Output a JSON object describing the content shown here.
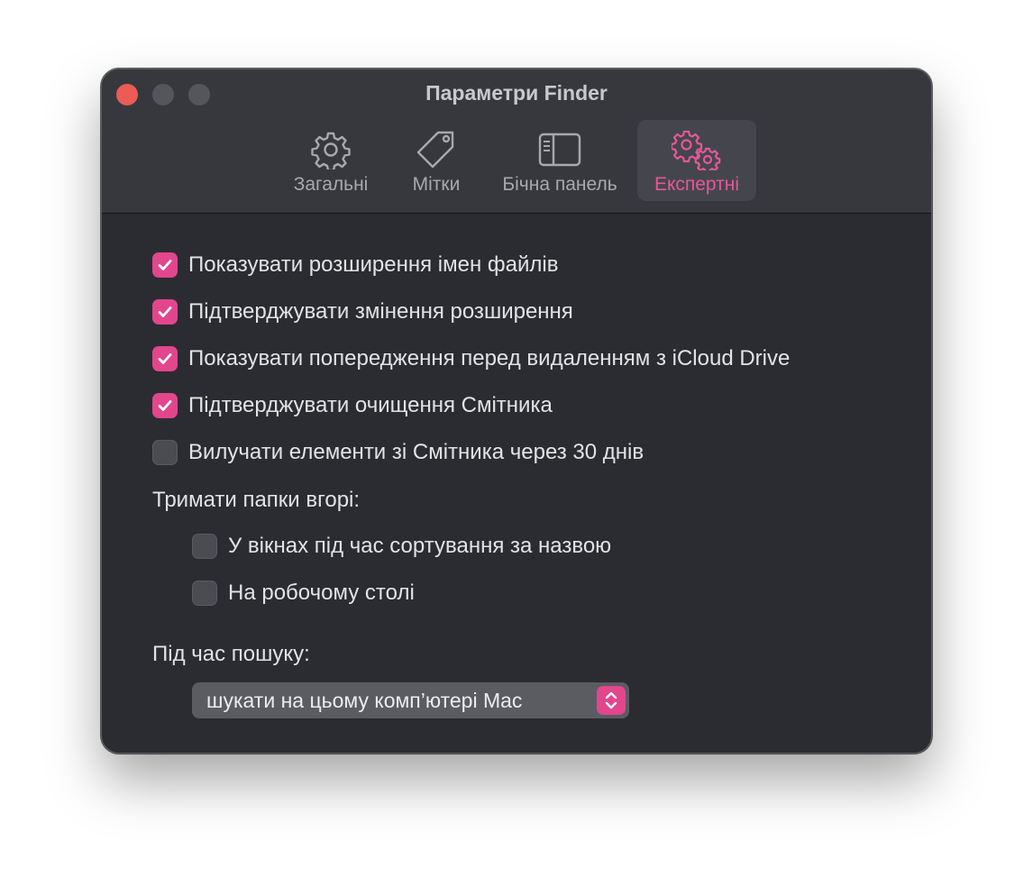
{
  "window": {
    "title": "Параметри Finder"
  },
  "tabs": [
    {
      "label": "Загальні",
      "icon": "gear-icon"
    },
    {
      "label": "Мітки",
      "icon": "tag-icon"
    },
    {
      "label": "Бічна панель",
      "icon": "sidebar-icon"
    },
    {
      "label": "Експертні",
      "icon": "gears-icon",
      "active": true
    }
  ],
  "options": [
    {
      "label": "Показувати розширення імен файлів",
      "checked": true
    },
    {
      "label": "Підтверджувати змінення розширення",
      "checked": true
    },
    {
      "label": "Показувати попередження перед видаленням з iCloud Drive",
      "checked": true
    },
    {
      "label": "Підтверджувати очищення Смітника",
      "checked": true
    },
    {
      "label": "Вилучати елементи зі Смітника через 30 днів",
      "checked": false
    }
  ],
  "folders_on_top": {
    "heading": "Тримати папки вгорі:",
    "options": [
      {
        "label": "У вікнах під час сортування за назвою",
        "checked": false
      },
      {
        "label": "На робочому столі",
        "checked": false
      }
    ]
  },
  "search": {
    "heading": "Під час пошуку:",
    "selected": "шукати на цьому комп’ютері Mac"
  },
  "colors": {
    "accent": "#e2468d",
    "window_bg": "#2b2c31",
    "titlebar_bg": "#37383e",
    "active_tab_text": "#e65799"
  }
}
